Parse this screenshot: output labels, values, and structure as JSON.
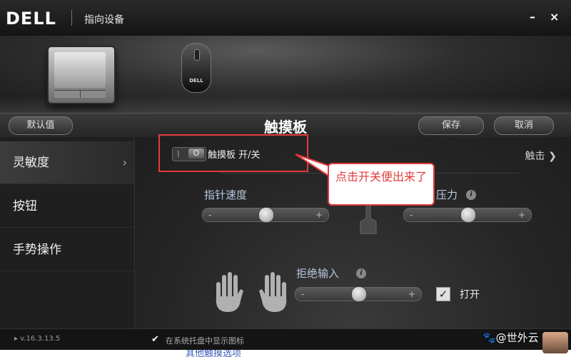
{
  "window": {
    "logo": "DELL",
    "title": "指向设备",
    "minimize": "–",
    "close": "×"
  },
  "devices": {
    "touchpad_brand": "",
    "mouse_brand": "DELL"
  },
  "toolbar": {
    "default_label": "默认值",
    "panel_title": "触摸板",
    "save_label": "保存",
    "cancel_label": "取消"
  },
  "sidebar": {
    "items": [
      {
        "label": "灵敏度",
        "arrow": "›"
      },
      {
        "label": "按钮"
      },
      {
        "label": "手势操作"
      }
    ]
  },
  "content": {
    "toggle": {
      "off_text": "I",
      "knob_text": "O",
      "label": "触摸板 开/关",
      "state": "off"
    },
    "touch_tab": "触击",
    "pointer_speed": {
      "label": "指针速度",
      "minus": "-",
      "plus": "+",
      "level": 0.5
    },
    "pressure": {
      "label": "压力",
      "minus": "-",
      "plus": "+",
      "level": 0.5
    },
    "palm_reject": {
      "label": "拒绝输入",
      "minus": "-",
      "plus": "+",
      "level": 0.5
    },
    "open_check": {
      "checked": true,
      "label": "打开"
    }
  },
  "annotation": {
    "callout_text": "点击开关便出来了",
    "color": "#e23b3b"
  },
  "status": {
    "version": "▸ v.16.3.13.5",
    "tray_checked": true,
    "tray_label": "在系统托盘中显示图标"
  },
  "page_below": {
    "text": "其他触摸选项"
  },
  "watermark": {
    "text": "🐾@世外云"
  }
}
